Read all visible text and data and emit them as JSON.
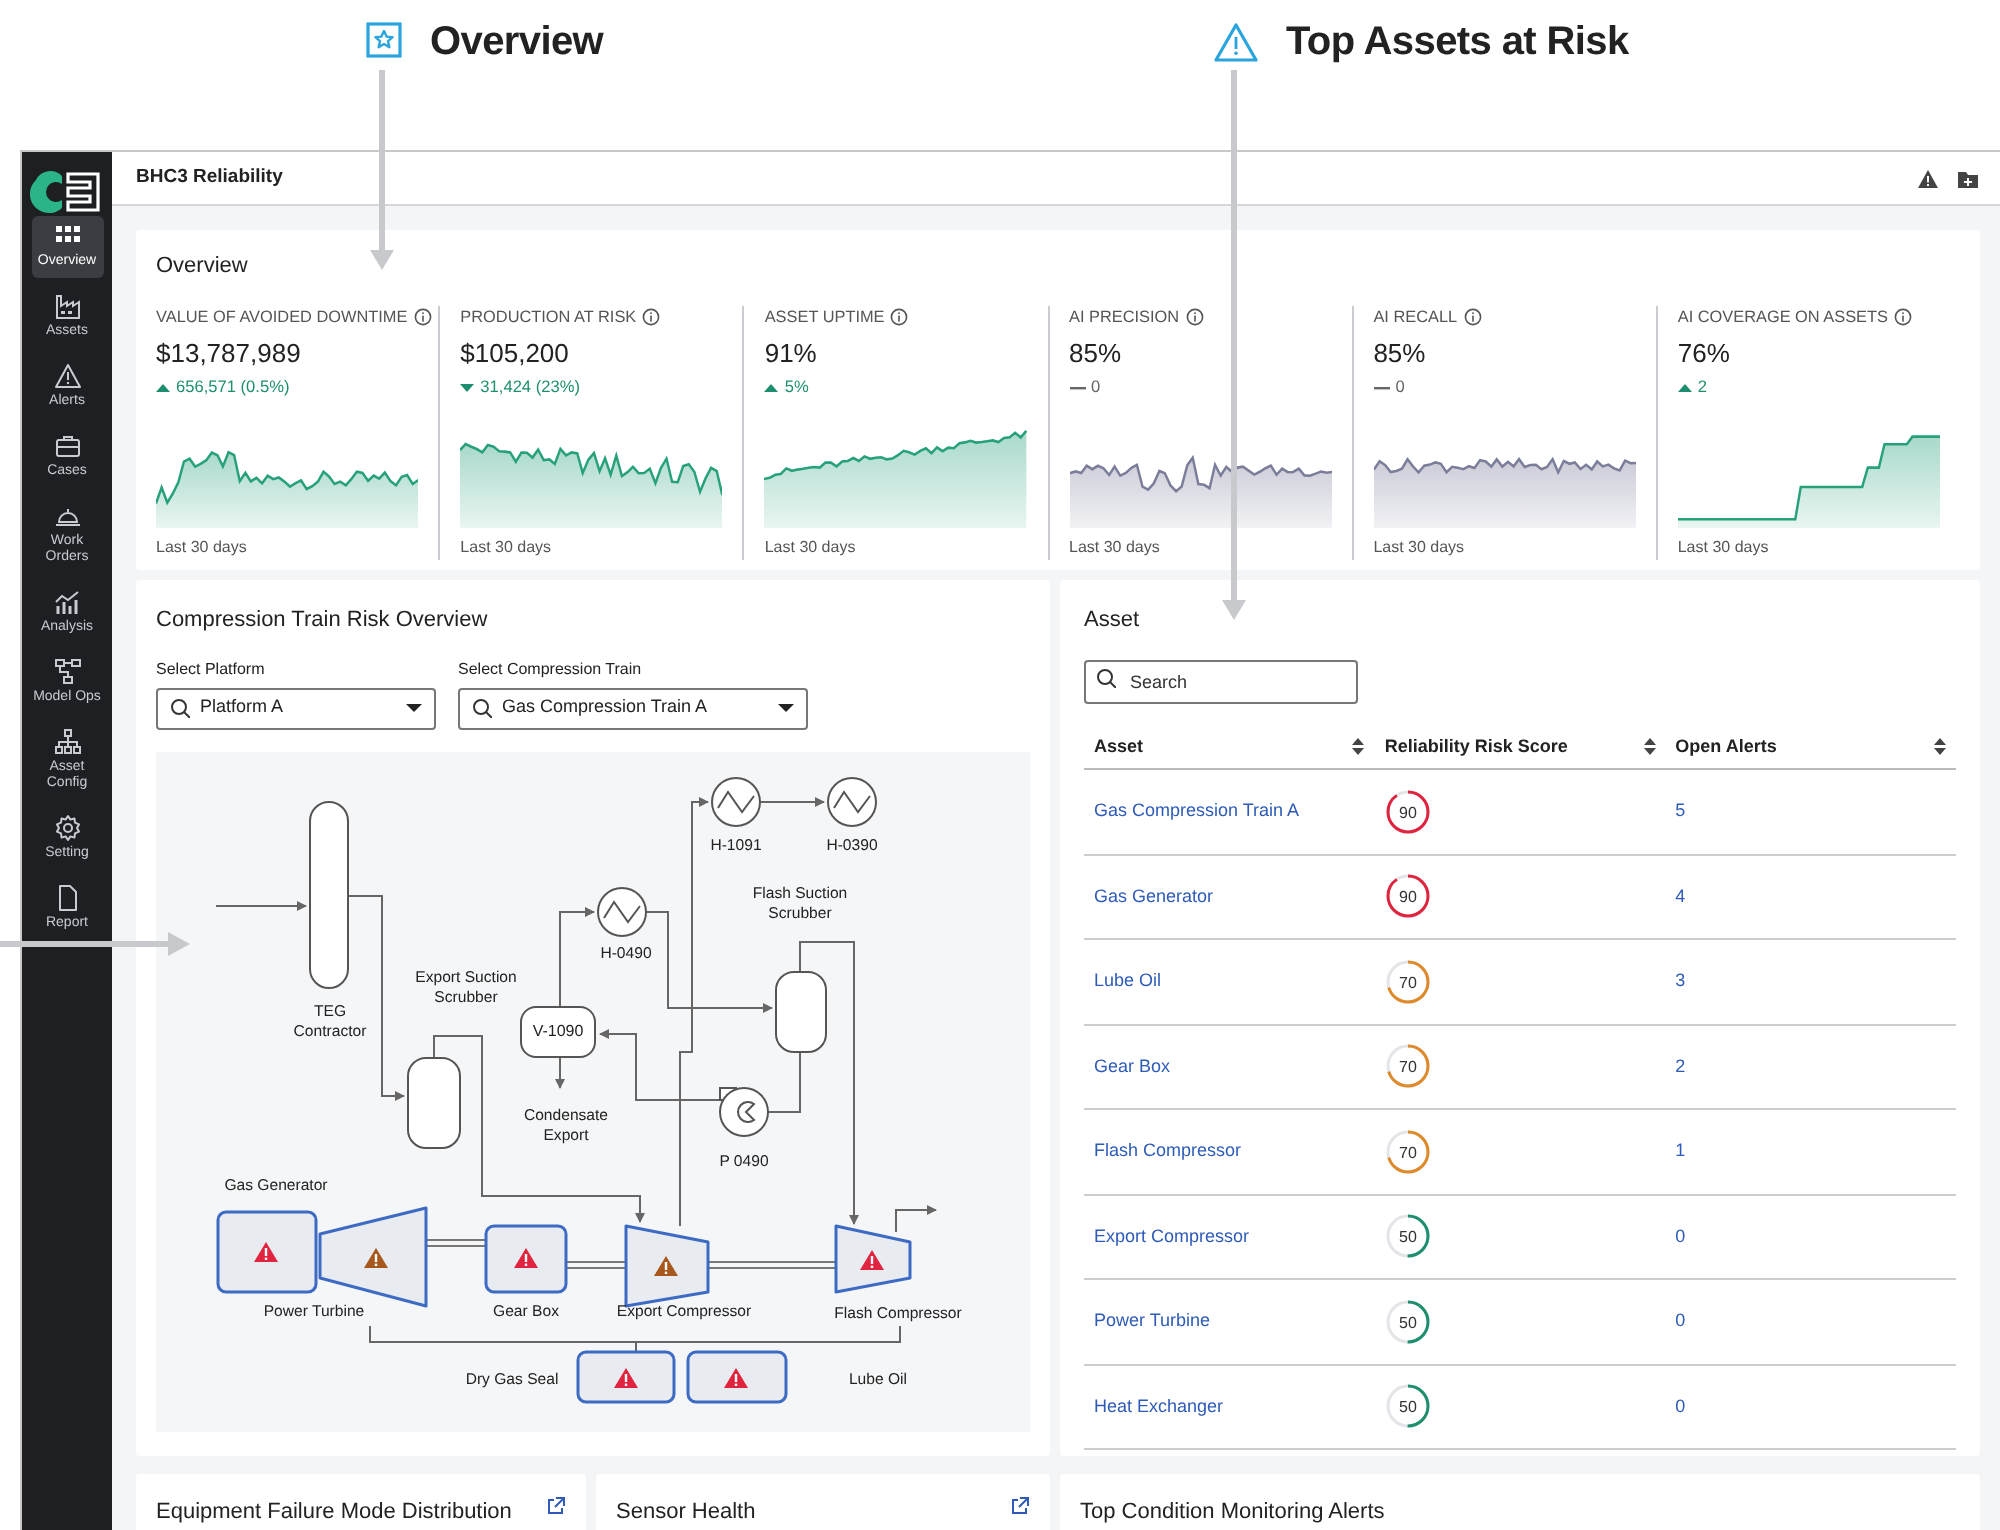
{
  "callouts": [
    {
      "label": "Overview",
      "kind": "star"
    },
    {
      "label": "Top Assets at Risk",
      "kind": "alert"
    }
  ],
  "app": {
    "title": "BHC3 Reliability"
  },
  "sidebar": {
    "items": [
      {
        "label": "Overview",
        "selected": true
      },
      {
        "label": "Assets",
        "selected": false
      },
      {
        "label": "Alerts",
        "selected": false
      },
      {
        "label": "Cases",
        "selected": false
      },
      {
        "label": "Work Orders",
        "selected": false
      },
      {
        "label": "Analysis",
        "selected": false
      },
      {
        "label": "Model Ops",
        "selected": false
      },
      {
        "label": "Asset Config",
        "selected": false
      },
      {
        "label": "Setting",
        "selected": false
      },
      {
        "label": "Report",
        "selected": false
      }
    ]
  },
  "overview": {
    "title": "Overview",
    "kpis": [
      {
        "label": "VALUE OF AVOIDED DOWNTIME",
        "value": "$13,787,989",
        "delta": "656,571 (0.5%)",
        "kind": "up",
        "period": "Last 30 days"
      },
      {
        "label": "PRODUCTION AT RISK",
        "value": "$105,200",
        "delta": "31,424 (23%)",
        "kind": "down",
        "period": "Last 30 days"
      },
      {
        "label": "ASSET UPTIME",
        "value": "91%",
        "delta": "5%",
        "kind": "up",
        "period": "Last 30 days"
      },
      {
        "label": "AI PRECISION",
        "value": "85%",
        "delta": "0",
        "kind": "flat",
        "period": "Last 30 days"
      },
      {
        "label": "AI RECALL",
        "value": "85%",
        "delta": "0",
        "kind": "flat",
        "period": "Last 30 days"
      },
      {
        "label": "AI COVERAGE ON ASSETS",
        "value": "76%",
        "delta": "2",
        "kind": "up",
        "period": "Last 30 days"
      }
    ]
  },
  "risk_overview": {
    "title": "Compression Train Risk Overview",
    "filters": [
      {
        "label": "Select Platform",
        "value": "Platform A"
      },
      {
        "label": "Select Compression Train",
        "value": "Gas Compression Train A"
      }
    ],
    "diagram": {
      "process_units": [
        {
          "label": "TEG Contractor"
        },
        {
          "label": "Export Suction Scrubber"
        },
        {
          "label": "V-1090"
        },
        {
          "label": "Condensate Export"
        },
        {
          "label": "H-0490"
        },
        {
          "label": "Flash Suction Scrubber"
        },
        {
          "label": "H-1091"
        },
        {
          "label": "H-0390"
        },
        {
          "label": "P 0490"
        }
      ],
      "equipment": [
        {
          "label": "Gas Generator",
          "color": "#e0243f"
        },
        {
          "label": "Power Turbine",
          "color": "#a8581c"
        },
        {
          "label": "Gear Box",
          "color": "#e0243f"
        },
        {
          "label": "Export Compressor",
          "color": "#a8581c"
        },
        {
          "label": "Flash Compressor",
          "color": "#e0243f"
        },
        {
          "label": "Dry Gas Seal",
          "color": "#e0243f"
        },
        {
          "label": "Lube Oil",
          "color": "#e0243f"
        }
      ]
    }
  },
  "asset_table": {
    "title": "Asset",
    "search": {
      "placeholder": "Search"
    },
    "columns": [
      "Asset",
      "Reliability Risk Score",
      "Open Alerts"
    ],
    "rows": [
      {
        "asset": "Gas Compression Train A",
        "score": "90",
        "color": "#e0243f",
        "open_alerts": "5"
      },
      {
        "asset": "Gas Generator",
        "score": "90",
        "color": "#e0243f",
        "open_alerts": "4"
      },
      {
        "asset": "Lube Oil",
        "score": "70",
        "color": "#de8a2a",
        "open_alerts": "3"
      },
      {
        "asset": "Gear Box",
        "score": "70",
        "color": "#de8a2a",
        "open_alerts": "2"
      },
      {
        "asset": "Flash Compressor",
        "score": "70",
        "color": "#de8a2a",
        "open_alerts": "1"
      },
      {
        "asset": "Export Compressor",
        "score": "50",
        "color": "#1e8f6e",
        "open_alerts": "0"
      },
      {
        "asset": "Power Turbine",
        "score": "50",
        "color": "#1e8f6e",
        "open_alerts": "0"
      },
      {
        "asset": "Heat Exchanger",
        "score": "50",
        "color": "#1e8f6e",
        "open_alerts": "0"
      }
    ]
  },
  "bottom_panels": [
    {
      "title": "Equipment Failure Mode Distribution",
      "external_link": true
    },
    {
      "title": "Sensor Health",
      "external_link": true
    },
    {
      "title": "Top Condition Monitoring Alerts",
      "external_link": false
    }
  ]
}
